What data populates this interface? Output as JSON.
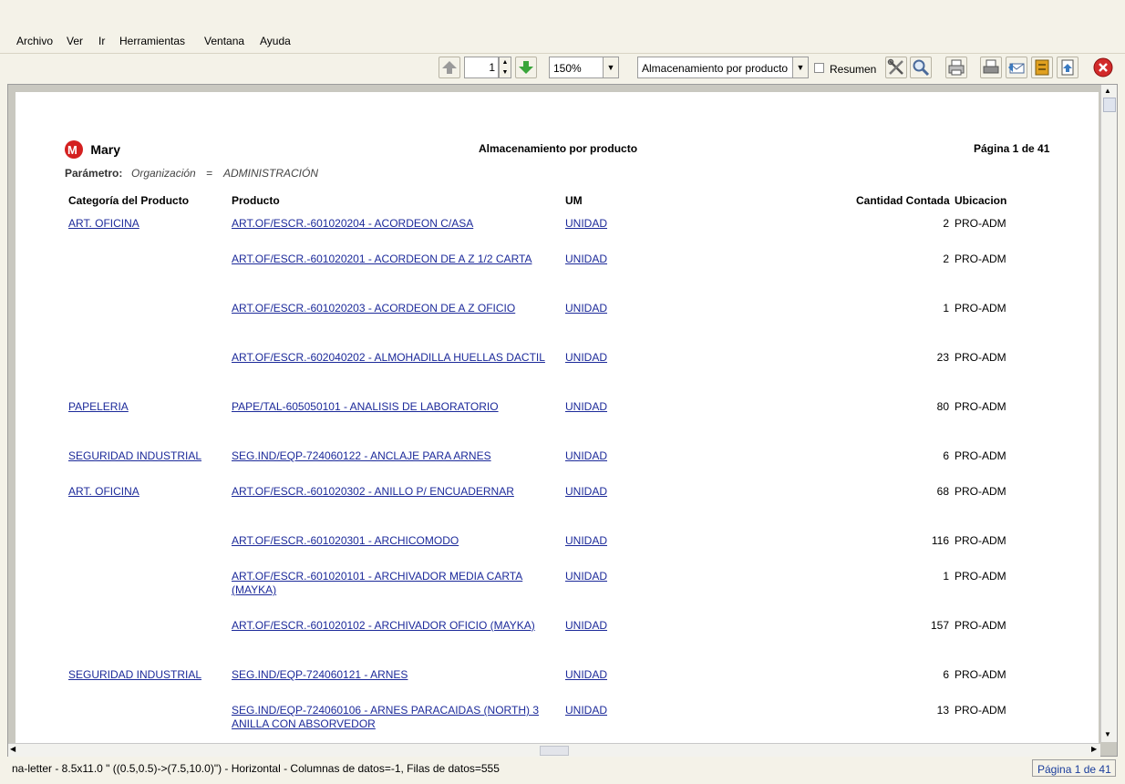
{
  "menu": [
    "Archivo",
    "Ver",
    "Ir",
    "Herramientas",
    "Ventana",
    "Ayuda"
  ],
  "toolbar": {
    "page_number": "1",
    "zoom": "150%",
    "report_select": "Almacenamiento por producto",
    "summary_label": "Resumen"
  },
  "report": {
    "logo_text": "Mary",
    "logo_sub": "",
    "title": "Almacenamiento por producto",
    "page_label": "Página 1 de 41",
    "param_label": "Parámetro:",
    "param_name": "Organización",
    "param_op": "=",
    "param_value": "ADMINISTRACIÓN",
    "headers": {
      "category": "Categoría del Producto",
      "product": "Producto",
      "um": "UM",
      "qty": "Cantidad Contada",
      "location": "Ubicacion"
    },
    "rows": [
      {
        "category": "ART. OFICINA",
        "product": "ART.OF/ESCR.-601020204 - ACORDEON C/ASA",
        "um": "UNIDAD",
        "qty": "2",
        "location": "PRO-ADM"
      },
      {
        "category": "",
        "product": "ART.OF/ESCR.-601020201 - ACORDEON DE A Z 1/2 CARTA",
        "um": "UNIDAD",
        "qty": "2",
        "location": "PRO-ADM"
      },
      {
        "category": "",
        "product": "ART.OF/ESCR.-601020203 - ACORDEON DE A Z OFICIO",
        "um": "UNIDAD",
        "qty": "1",
        "location": "PRO-ADM"
      },
      {
        "category": "",
        "product": "ART.OF/ESCR.-602040202 - ALMOHADILLA HUELLAS DACTIL",
        "um": "UNIDAD",
        "qty": "23",
        "location": "PRO-ADM"
      },
      {
        "category": "PAPELERIA",
        "product": "PAPE/TAL-605050101 - ANALISIS DE LABORATORIO",
        "um": "UNIDAD",
        "qty": "80",
        "location": "PRO-ADM"
      },
      {
        "category": "SEGURIDAD INDUSTRIAL",
        "product": "SEG.IND/EQP-724060122 - ANCLAJE PARA ARNES",
        "um": "UNIDAD",
        "qty": "6",
        "location": "PRO-ADM"
      },
      {
        "category": "ART. OFICINA",
        "product": "ART.OF/ESCR.-601020302 - ANILLO P/ ENCUADERNAR",
        "um": "UNIDAD",
        "qty": "68",
        "location": "PRO-ADM"
      },
      {
        "category": "",
        "product": "ART.OF/ESCR.-601020301 - ARCHICOMODO",
        "um": "UNIDAD",
        "qty": "116",
        "location": "PRO-ADM"
      },
      {
        "category": "",
        "product": "ART.OF/ESCR.-601020101 - ARCHIVADOR MEDIA CARTA (MAYKA)",
        "um": "UNIDAD",
        "qty": "1",
        "location": "PRO-ADM"
      },
      {
        "category": "",
        "product": "ART.OF/ESCR.-601020102 - ARCHIVADOR OFICIO (MAYKA)",
        "um": "UNIDAD",
        "qty": "157",
        "location": "PRO-ADM"
      },
      {
        "category": "SEGURIDAD INDUSTRIAL",
        "product": "SEG.IND/EQP-724060121 - ARNES",
        "um": "UNIDAD",
        "qty": "6",
        "location": "PRO-ADM"
      },
      {
        "category": "",
        "product": "SEG.IND/EQP-724060106 - ARNES PARACAIDAS (NORTH) 3 ANILLA CON ABSORVEDOR",
        "um": "UNIDAD",
        "qty": "13",
        "location": "PRO-ADM"
      }
    ]
  },
  "status": {
    "text": "na-letter - 8.5x11.0 \" ((0.5,0.5)->(7.5,10.0)\") - Horizontal - Columnas de datos=-1, Filas de datos=555",
    "page": "Página 1 de 41"
  },
  "colors": {
    "link": "#1c2a9a",
    "logo_red": "#d42020",
    "close_red": "#d22a2a"
  }
}
